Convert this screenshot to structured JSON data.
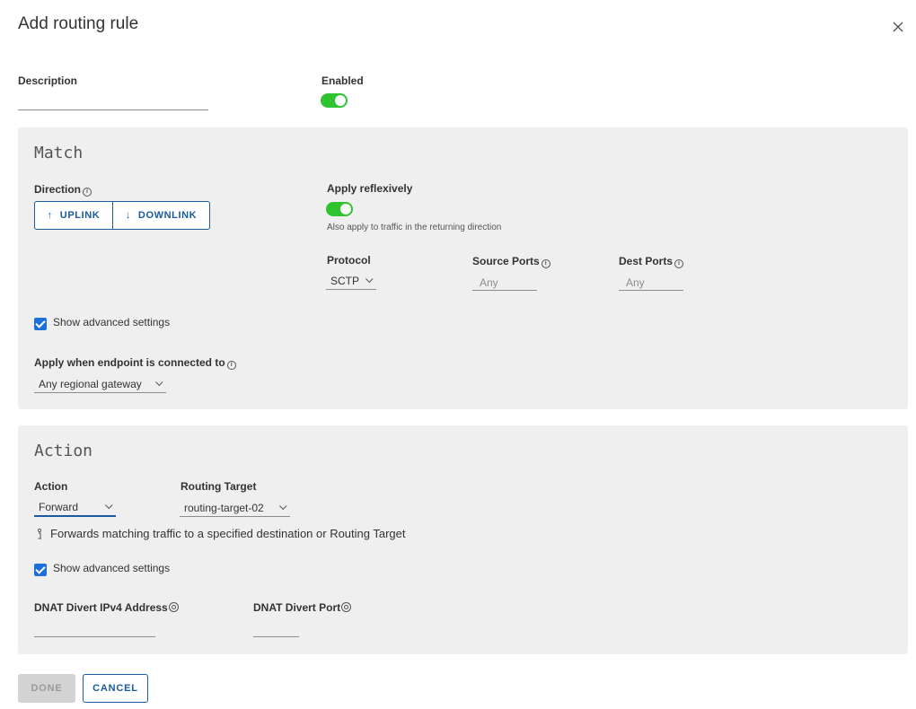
{
  "dialog": {
    "title": "Add routing rule"
  },
  "general": {
    "description_label": "Description",
    "description_value": "",
    "enabled_label": "Enabled",
    "enabled": true
  },
  "match": {
    "title": "Match",
    "direction_label": "Direction",
    "direction_options": [
      {
        "arrow": "↑",
        "label": "UPLINK"
      },
      {
        "arrow": "↓",
        "label": "DOWNLINK"
      }
    ],
    "reflexive_label": "Apply reflexively",
    "reflexive_enabled": true,
    "reflexive_help": "Also apply to traffic in the returning direction",
    "protocol_label": "Protocol",
    "protocol_value": "SCTP",
    "source_ports_label": "Source Ports",
    "source_ports_placeholder": "Any",
    "dest_ports_label": "Dest Ports",
    "dest_ports_placeholder": "Any",
    "advanced_label": "Show advanced settings",
    "advanced_checked": true,
    "endpoint_label": "Apply when endpoint is connected to",
    "endpoint_value": "Any regional gateway"
  },
  "action": {
    "title": "Action",
    "action_label": "Action",
    "action_value": "Forward",
    "routing_target_label": "Routing Target",
    "routing_target_value": "routing-target-02",
    "hint_text": "Forwards matching traffic to a specified destination or Routing Target",
    "advanced_label": "Show advanced settings",
    "advanced_checked": true,
    "dnat_ip_label": "DNAT Divert IPv4 Address",
    "dnat_ip_value": "",
    "dnat_port_label": "DNAT Divert Port",
    "dnat_port_value": ""
  },
  "footer": {
    "done_label": "DONE",
    "cancel_label": "CANCEL"
  },
  "colors": {
    "toggle_on": "#2fc32f",
    "primary": "#1a5aa0",
    "checkbox": "#1e6fd9",
    "panel_bg": "#efefef"
  }
}
